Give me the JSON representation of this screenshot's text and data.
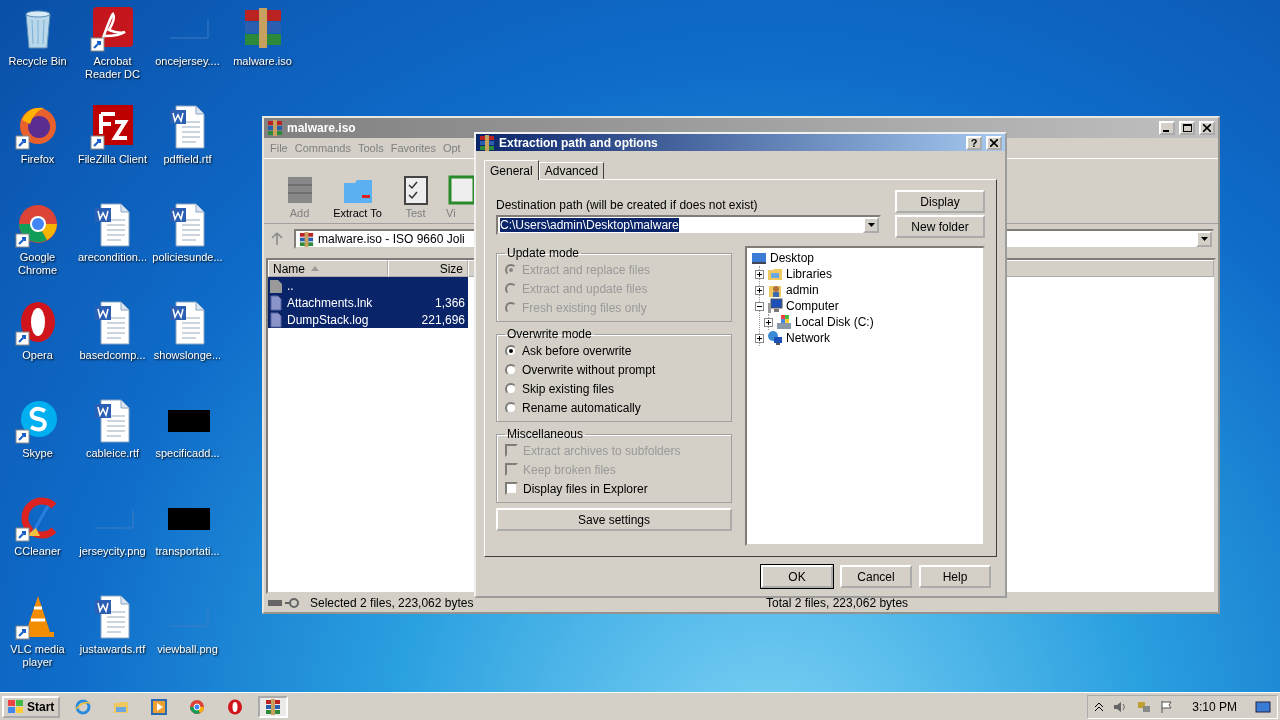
{
  "desktop": {
    "icons": [
      {
        "label": "Recycle Bin",
        "kind": "recycle",
        "shortcut": false
      },
      {
        "label": "Firefox",
        "kind": "firefox",
        "shortcut": true
      },
      {
        "label": "Google Chrome",
        "kind": "chrome",
        "shortcut": true
      },
      {
        "label": "Opera",
        "kind": "opera",
        "shortcut": true
      },
      {
        "label": "Skype",
        "kind": "skype",
        "shortcut": true
      },
      {
        "label": "CCleaner",
        "kind": "ccleaner",
        "shortcut": true
      },
      {
        "label": "VLC media player",
        "kind": "vlc",
        "shortcut": true
      },
      {
        "label": "Acrobat Reader DC",
        "kind": "acrobat",
        "shortcut": true
      },
      {
        "label": "FileZilla Client",
        "kind": "filezilla",
        "shortcut": true
      },
      {
        "label": "arecondition...",
        "kind": "word",
        "shortcut": false
      },
      {
        "label": "basedcomp...",
        "kind": "word",
        "shortcut": false
      },
      {
        "label": "cableice.rtf",
        "kind": "word",
        "shortcut": false
      },
      {
        "label": "jerseycity.png",
        "kind": "blank",
        "shortcut": false
      },
      {
        "label": "justawards.rtf",
        "kind": "word",
        "shortcut": false
      },
      {
        "label": "oncejersey....",
        "kind": "blank",
        "shortcut": false
      },
      {
        "label": "pdffield.rtf",
        "kind": "word",
        "shortcut": false
      },
      {
        "label": "policiesunde...",
        "kind": "word",
        "shortcut": false
      },
      {
        "label": "showslonge...",
        "kind": "word",
        "shortcut": false
      },
      {
        "label": "specificadd...",
        "kind": "black",
        "shortcut": false
      },
      {
        "label": "transportati...",
        "kind": "black",
        "shortcut": false
      },
      {
        "label": "viewball.png",
        "kind": "blank",
        "shortcut": false
      },
      {
        "label": "malware.iso",
        "kind": "winrar",
        "shortcut": false
      }
    ]
  },
  "archive_window": {
    "title": "malware.iso",
    "menu": [
      "File",
      "Commands",
      "Tools",
      "Favorites",
      "Opt"
    ],
    "toolbar": [
      {
        "label": "Add",
        "kind": "add"
      },
      {
        "label": "Extract To",
        "kind": "extract"
      },
      {
        "label": "Test",
        "kind": "test"
      },
      {
        "label": "Vi",
        "kind": "view"
      }
    ],
    "address": "malware.iso - ISO 9660 Joli",
    "columns": [
      "Name",
      "Size"
    ],
    "rows": [
      {
        "name": "..",
        "kind": "up",
        "selected": true
      },
      {
        "name": "Attachments.lnk",
        "size": "1,366",
        "kind": "file",
        "selected": true
      },
      {
        "name": "DumpStack.log",
        "size": "221,696",
        "kind": "file",
        "selected": true
      }
    ],
    "status": [
      "Selected 2 files, 223,062 bytes",
      "Total 2 files, 223,062 bytes"
    ]
  },
  "dialog": {
    "title": "Extraction path and options",
    "help_button": "?",
    "tabs": [
      {
        "label": "General",
        "selected": true
      },
      {
        "label": "Advanced",
        "selected": false
      }
    ],
    "destination_label": "Destination path (will be created if does not exist)",
    "destination_path": "C:\\Users\\admin\\Desktop\\malware",
    "side_buttons": [
      "Display",
      "New folder"
    ],
    "groups": [
      {
        "title": "Update mode",
        "kind": "radio",
        "options": [
          {
            "label": "Extract and replace files",
            "selected": true,
            "disabled": true
          },
          {
            "label": "Extract and update files",
            "selected": false,
            "disabled": true
          },
          {
            "label": "Fresh existing files only",
            "selected": false,
            "disabled": true
          }
        ]
      },
      {
        "title": "Overwrite mode",
        "kind": "radio",
        "options": [
          {
            "label": "Ask before overwrite",
            "selected": true,
            "disabled": false
          },
          {
            "label": "Overwrite without prompt",
            "selected": false,
            "disabled": false
          },
          {
            "label": "Skip existing files",
            "selected": false,
            "disabled": false
          },
          {
            "label": "Rename automatically",
            "selected": false,
            "disabled": false
          }
        ]
      },
      {
        "title": "Miscellaneous",
        "kind": "checkbox",
        "options": [
          {
            "label": "Extract archives to subfolders",
            "checked": false,
            "disabled": true
          },
          {
            "label": "Keep broken files",
            "checked": false,
            "disabled": true
          },
          {
            "label": "Display files in Explorer",
            "checked": false,
            "disabled": false
          }
        ]
      }
    ],
    "save_button": "Save settings",
    "tree": [
      {
        "label": "Desktop",
        "kind": "desktop",
        "children": [
          {
            "label": "Libraries",
            "kind": "libraries",
            "expanded": false
          },
          {
            "label": "admin",
            "kind": "user",
            "expanded": false
          },
          {
            "label": "Computer",
            "kind": "computer",
            "expanded": true,
            "children": [
              {
                "label": "Local Disk (C:)",
                "kind": "drive",
                "expanded": false
              }
            ]
          },
          {
            "label": "Network",
            "kind": "network",
            "expanded": false
          }
        ]
      }
    ],
    "buttons": [
      {
        "label": "OK",
        "default": true
      },
      {
        "label": "Cancel",
        "default": false
      },
      {
        "label": "Help",
        "default": false
      }
    ]
  },
  "taskbar": {
    "start": "Start",
    "apps": [
      {
        "kind": "ie",
        "active": false
      },
      {
        "kind": "explorer",
        "active": false
      },
      {
        "kind": "media",
        "active": false
      },
      {
        "kind": "chrome",
        "active": false
      },
      {
        "kind": "opera",
        "active": false
      },
      {
        "kind": "winrar",
        "active": true
      }
    ],
    "clock": "3:10 PM"
  }
}
